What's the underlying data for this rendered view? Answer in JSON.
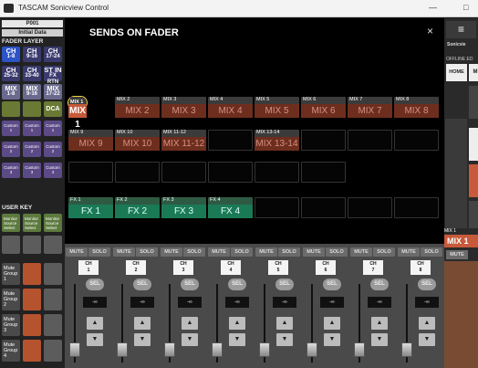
{
  "window": {
    "title": "TASCAM Sonicview Control",
    "minimize": "—",
    "maximize": "□"
  },
  "left": {
    "preset_id": "P001",
    "preset_name": "Initial Data",
    "fader_layer_label": "FADER LAYER",
    "layers": [
      {
        "top": "CH",
        "bottom": "1-8"
      },
      {
        "top": "CH",
        "bottom": "9-16"
      },
      {
        "top": "CH",
        "bottom": "17-24"
      },
      {
        "top": "CH",
        "bottom": "25-32"
      },
      {
        "top": "CH",
        "bottom": "33-40"
      },
      {
        "top": "ST IN",
        "bottom": "FX RTN"
      },
      {
        "top": "MIX",
        "bottom": "1-8"
      },
      {
        "top": "MIX",
        "bottom": "9-16"
      },
      {
        "top": "MIX",
        "bottom": "17-22"
      }
    ],
    "dca_label": "DCA",
    "custom_buttons": [
      {
        "top": "Custom",
        "bottom": "1"
      },
      {
        "top": "Custom",
        "bottom": "1"
      },
      {
        "top": "Custom",
        "bottom": "1"
      },
      {
        "top": "Custom",
        "bottom": "2"
      },
      {
        "top": "Custom",
        "bottom": "2"
      },
      {
        "top": "Custom",
        "bottom": "2"
      },
      {
        "top": "Custom",
        "bottom": "3"
      },
      {
        "top": "Custom",
        "bottom": "3"
      },
      {
        "top": "Custom",
        "bottom": "3"
      }
    ],
    "user_key_label": "USER KEY",
    "user_keys_top": [
      {
        "l1": "Monitor",
        "l2": "Source",
        "l3": "Select"
      },
      {
        "l1": "Monitor",
        "l2": "Source",
        "l3": "Select"
      },
      {
        "l1": "Monitor",
        "l2": "Source",
        "l3": "Select"
      }
    ],
    "user_keys_bottom": [
      {
        "l1": "Mute",
        "l2": "Group",
        "l3": "1",
        "n": "1"
      },
      {
        "l1": "Mute",
        "l2": "Group",
        "l3": "2",
        "n": "2"
      },
      {
        "l1": "Mute",
        "l2": "Group",
        "l3": "3",
        "n": "3"
      },
      {
        "l1": "Mute",
        "l2": "Group",
        "l3": "4",
        "n": "4"
      }
    ]
  },
  "modal": {
    "title": "SENDS ON FADER",
    "close": "×",
    "mix_rows": [
      [
        {
          "small": "MIX 1",
          "big": "MIX 1",
          "selected": true
        },
        {
          "small": "MIX 2",
          "big": "MIX 2"
        },
        {
          "small": "MIX 3",
          "big": "MIX 3"
        },
        {
          "small": "MIX 4",
          "big": "MIX 4"
        },
        {
          "small": "MIX 5",
          "big": "MIX 5"
        },
        {
          "small": "MIX 6",
          "big": "MIX 6"
        },
        {
          "small": "MIX 7",
          "big": "MIX 7"
        },
        {
          "small": "MIX 8",
          "big": "MIX 8"
        }
      ],
      [
        {
          "small": "MIX 9",
          "big": "MIX 9"
        },
        {
          "small": "MIX 10",
          "big": "MIX 10"
        },
        {
          "small": "MIX 11-12",
          "big": "MIX 11-12"
        },
        {
          "small": "",
          "big": ""
        },
        {
          "small": "MIX 13-14",
          "big": "MIX 13-14"
        },
        {
          "small": "",
          "big": ""
        }
      ]
    ],
    "fx_row": [
      {
        "small": "FX 1",
        "big": "FX 1"
      },
      {
        "small": "FX 2",
        "big": "FX 2"
      },
      {
        "small": "FX 3",
        "big": "FX 3"
      },
      {
        "small": "FX 4",
        "big": "FX 4"
      }
    ]
  },
  "strips": [
    {
      "ch": "CH",
      "num": "1",
      "mute": "MUTE",
      "solo": "SOLO",
      "sel": "SEL",
      "level": "-∞",
      "up": "▲",
      "down": "▼"
    },
    {
      "ch": "CH",
      "num": "2",
      "mute": "MUTE",
      "solo": "SOLO",
      "sel": "SEL",
      "level": "-∞",
      "up": "▲",
      "down": "▼"
    },
    {
      "ch": "CH",
      "num": "3",
      "mute": "MUTE",
      "solo": "SOLO",
      "sel": "SEL",
      "level": "-∞",
      "up": "▲",
      "down": "▼"
    },
    {
      "ch": "CH",
      "num": "4",
      "mute": "MUTE",
      "solo": "SOLO",
      "sel": "SEL",
      "level": "-∞",
      "up": "▲",
      "down": "▼"
    },
    {
      "ch": "CH",
      "num": "5",
      "mute": "MUTE",
      "solo": "SOLO",
      "sel": "SEL",
      "level": "-∞",
      "up": "▲",
      "down": "▼"
    },
    {
      "ch": "CH",
      "num": "6",
      "mute": "MUTE",
      "solo": "SOLO",
      "sel": "SEL",
      "level": "-∞",
      "up": "▲",
      "down": "▼"
    },
    {
      "ch": "CH",
      "num": "7",
      "mute": "MUTE",
      "solo": "SOLO",
      "sel": "SEL",
      "level": "-∞",
      "up": "▲",
      "down": "▼"
    },
    {
      "ch": "CH",
      "num": "8",
      "mute": "MUTE",
      "solo": "SOLO",
      "sel": "SEL",
      "level": "-∞",
      "up": "▲",
      "down": "▼"
    }
  ],
  "right": {
    "menu_icon": "≡",
    "device": "Sonicvie",
    "offline": "OFFLINE ED",
    "home": "HOME",
    "m": "M",
    "mix1_small": "MIX 1",
    "mix1_big": "MIX 1",
    "mute": "MUTE"
  }
}
